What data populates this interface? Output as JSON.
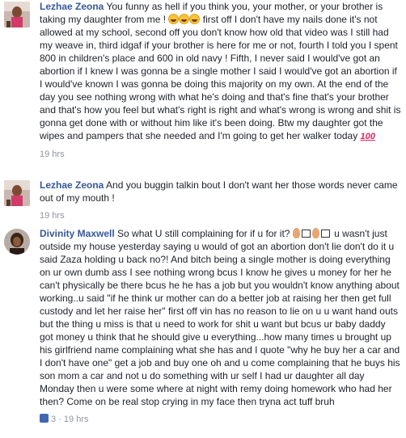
{
  "comments": [
    {
      "author": "Lezhae Zeona",
      "text_1": "You funny as hell if you think you, your mother, or your brother is taking my daughter from me !",
      "text_2": " first off I don't have my nails done it's not allowed at my school, second off you don't know how old that video was I still had my weave in, third idgaf if your brother is here for me or not, fourth I told you I spent 800 in children's place and 600 in old navy ! Fifth, I never said I would've got an abortion if I knew I was gonna be a single mother I said I would've got an abortion if I would've known I was gonna be doing this majority on my own. At the end of the day you see nothing wrong with what he's doing and that's fine that's your brother and that's how you feel but what's right is right and what's wrong is wrong and shit is gonna get done with or without him like it's been doing. Btw my daughter got the wipes and pampers that she needed and I'm going to get her walker today ",
      "emoji_end": "100",
      "time": "19 hrs"
    },
    {
      "author": "Lezhae Zeona",
      "text_1": "And you buggin talkin bout I don't want her those words never came out of my mouth !",
      "time": "19 hrs"
    },
    {
      "author": "Divinity Maxwell",
      "text_1": "So what U still complaining for if u for it?",
      "text_2": " u wasn't just outside my house yesterday saying u would of got an abortion don't lie don't do it u said Zaza holding u back no?! And bitch being a single mother is doing everything on ur own dumb ass I see nothing wrong bcus I know he gives u money for her he can't physically be there bcus he he has a job but you wouldn't know anything about working..u said \"if he think ur mother can do a better job at raising her then get full custody and let her raise her\" first off vin has no reason to lie on u u want hand outs but the thing u miss is that u need to work for shit u want but bcus ur baby daddy got money u think that he should give u everything...how many times u brought up his girlfriend name complaining what she has and I quote \"why he buy her a car and I don't have one\" get a job and buy one oh and u come complaining that he buys his son mom a car and not u do something with ur self I had ur daughter all day Monday then u were some where at night with remy doing homework who had her then? Come on be real stop crying in my face then tryna act tuff bruh",
      "likes": "3",
      "separator": "·",
      "time": "19 hrs"
    }
  ],
  "colors": {
    "name": "#365899",
    "meta": "#90949c",
    "text": "#1d2129"
  }
}
